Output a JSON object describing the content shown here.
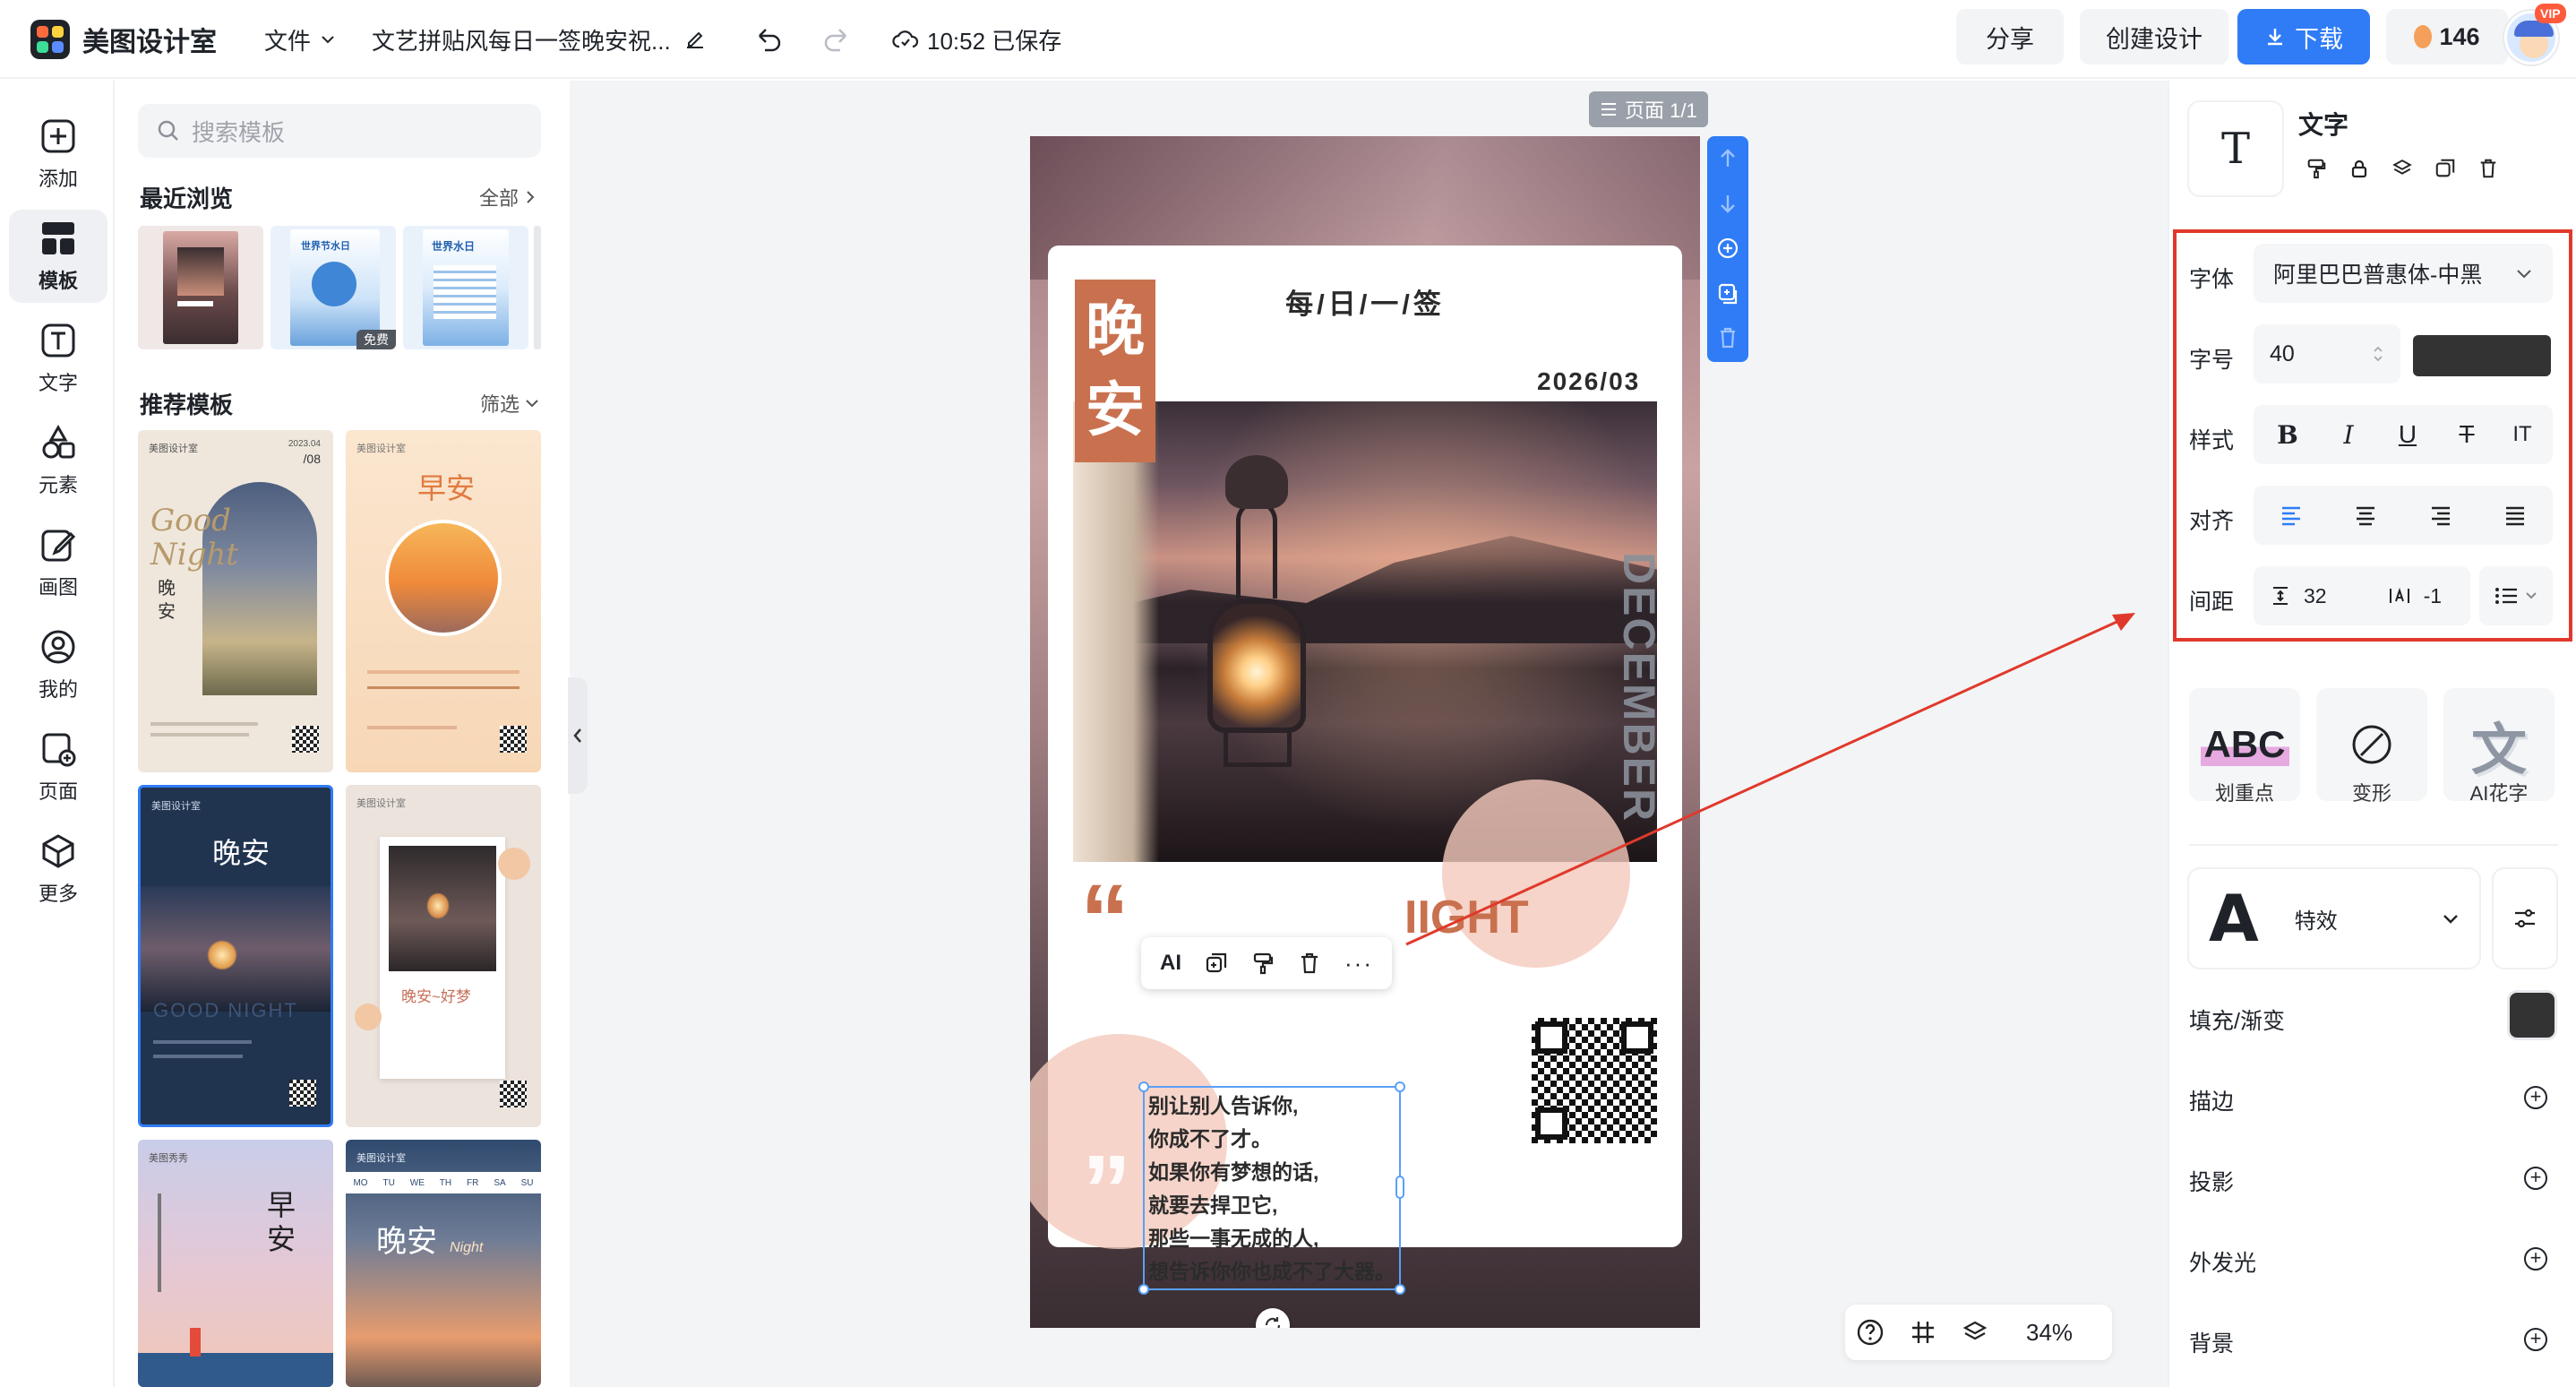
{
  "app": {
    "name": "美图设计室"
  },
  "topbar": {
    "file_menu": "文件",
    "doc_title": "文艺拼贴风每日一签晚安祝...",
    "save_status": "10:52 已保存",
    "share": "分享",
    "create": "创建设计",
    "download": "下载",
    "credits": "146",
    "vip_badge": "VIP"
  },
  "nav": [
    {
      "label": "添加",
      "icon": "add-icon"
    },
    {
      "label": "模板",
      "icon": "template-icon"
    },
    {
      "label": "文字",
      "icon": "text-icon"
    },
    {
      "label": "元素",
      "icon": "element-icon"
    },
    {
      "label": "画图",
      "icon": "draw-icon"
    },
    {
      "label": "我的",
      "icon": "user-icon"
    },
    {
      "label": "页面",
      "icon": "page-icon"
    },
    {
      "label": "更多",
      "icon": "more-icon"
    }
  ],
  "panel": {
    "search_placeholder": "搜索模板",
    "recent_title": "最近浏览",
    "recent_all": "全部",
    "free_badge": "免费",
    "recommend_title": "推荐模板",
    "filter": "筛选",
    "recent_thumbs": [
      {
        "text": ""
      },
      {
        "text": "世界节水日"
      },
      {
        "text": "世界水日"
      }
    ],
    "templates": [
      {
        "brand": "美图设计室",
        "title": "Good Night",
        "sub": "晚安",
        "date": "2023.04",
        "date2": "/08"
      },
      {
        "brand": "美图设计室",
        "title": "早安"
      },
      {
        "brand": "美图设计室",
        "title": "晚安",
        "sub": "GOOD NIGHT"
      },
      {
        "brand": "美图设计室",
        "title": "晚安~好梦"
      },
      {
        "brand": "美图秀秀",
        "title": "早安"
      },
      {
        "brand": "美图设计室",
        "title": "晚安",
        "sub": "Night",
        "week": [
          "MO",
          "TU",
          "WE",
          "TH",
          "FR",
          "SA",
          "SU"
        ]
      }
    ]
  },
  "canvas": {
    "page_label": "页面 1/1",
    "zoom": "34%",
    "poster": {
      "header": "每/日/一/签",
      "badge_line1": "晚",
      "badge_line2": "安",
      "date": "2026/03",
      "vertical_text": "DECEMBER",
      "night_text": "IIGHT",
      "quote_lines": [
        "别让别人告诉你,",
        "你成不了才。",
        "如果你有梦想的话,",
        "就要去捍卫它,",
        "那些一事无成的人,",
        "想告诉你你也成不了大器。"
      ]
    },
    "text_toolbar": {
      "ai": "AI"
    }
  },
  "right": {
    "element_title": "文字",
    "font_label": "字体",
    "font_value": "阿里巴巴普惠体-中黑",
    "size_label": "字号",
    "size_value": "40",
    "text_color": "#333333",
    "style_label": "样式",
    "style_buttons": [
      "B",
      "I",
      "U",
      "T",
      "IT"
    ],
    "align_label": "对齐",
    "spacing_label": "间距",
    "line_spacing": "32",
    "letter_spacing": "-1",
    "effects": [
      {
        "label": "划重点",
        "glyph": "ABC"
      },
      {
        "label": "变形",
        "glyph": "⊘"
      },
      {
        "label": "AI花字",
        "glyph": "文"
      }
    ],
    "effect_preview": "A",
    "effect_dropdown": "特效",
    "fill_label": "填充/渐变",
    "fill_color": "#333333",
    "stroke_label": "描边",
    "shadow_label": "投影",
    "glow_label": "外发光",
    "background_label": "背景"
  },
  "colors": {
    "primary": "#2f7cf6",
    "accent_orange": "#c9714f",
    "highlight_red": "#e0392b"
  }
}
